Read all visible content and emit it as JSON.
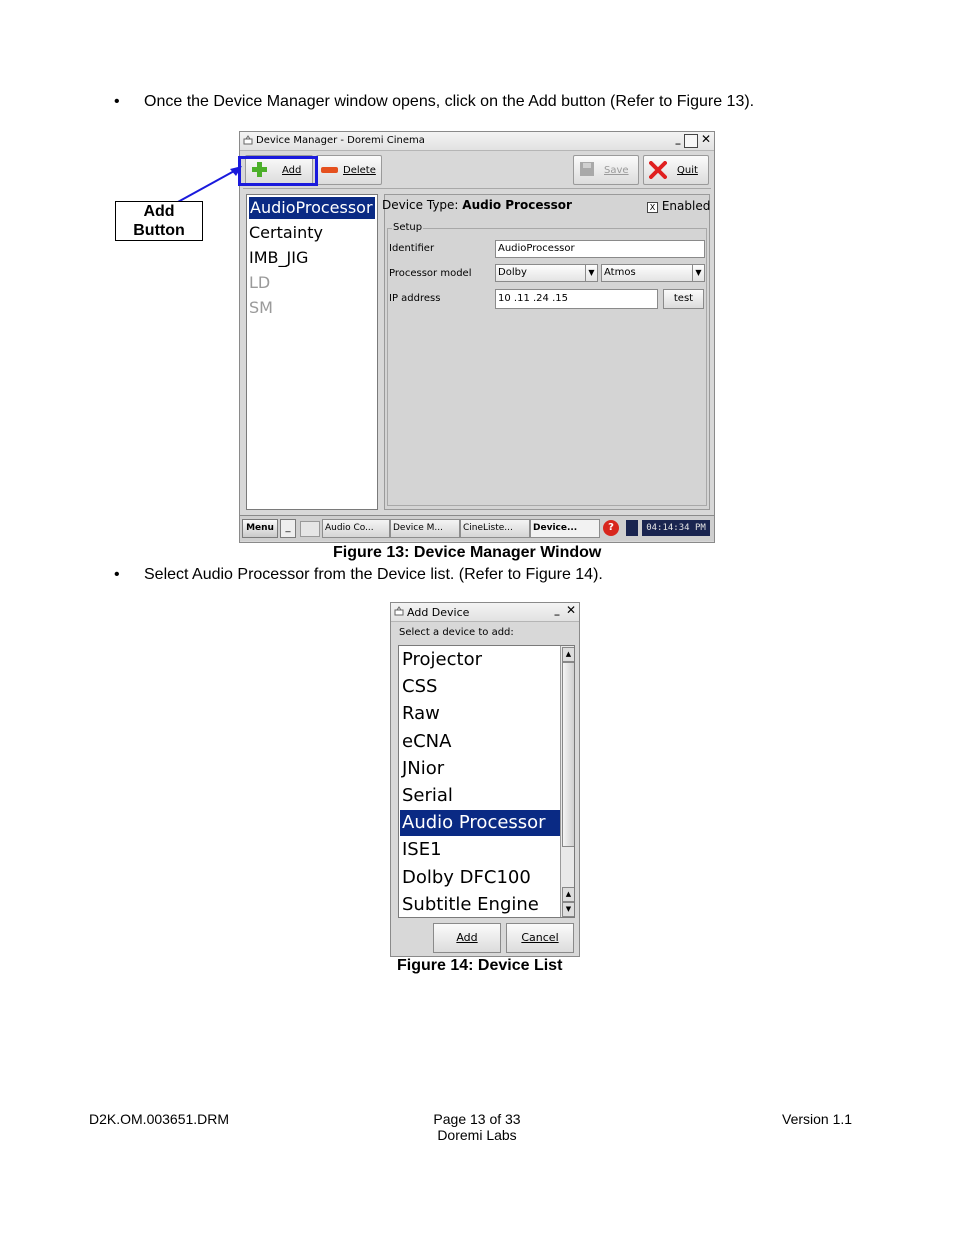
{
  "doc": {
    "bullet1": "Once the Device Manager window opens, click on the Add button (Refer to Figure 13).",
    "bullet2": "Select Audio Processor from the Device list. (Refer to Figure 14).",
    "bullet_char": "•",
    "figure13_caption": "Figure 13: Device Manager Window",
    "figure14_caption": "Figure 14: Device List",
    "callout_label_1": "Add",
    "callout_label_2": "Button",
    "callout_color": "#1a1adc"
  },
  "device_manager": {
    "title": "Device Manager - Doremi Cinema",
    "add_label": "Add",
    "delete_label": "Delete",
    "save_label": "Save",
    "quit_label": "Quit",
    "devices": [
      {
        "label": "AudioProcessor",
        "state": "selected"
      },
      {
        "label": "Certainty",
        "state": "normal"
      },
      {
        "label": "IMB_JIG",
        "state": "normal"
      },
      {
        "label": "LD",
        "state": "disabled"
      },
      {
        "label": "SM",
        "state": "disabled"
      }
    ],
    "device_type_prefix": "Device Type:",
    "device_type_value": "Audio Processor",
    "enabled_check": "X",
    "enabled_label": "Enabled",
    "setup_group": "Setup",
    "identifier_label": "Identifier",
    "identifier_value": "AudioProcessor",
    "processor_model_label": "Processor model",
    "processor_brand": "Dolby",
    "processor_model": "Atmos",
    "ip_label": "IP address",
    "ip_value": "10 .11 .24 .15",
    "test_label": "test",
    "selection_color": "#0a2a84"
  },
  "taskbar": {
    "menu_label": "Menu",
    "items": [
      "Audio Co...",
      "Device M...",
      "CineListe...",
      "Device..."
    ],
    "clock": "04:14:34 PM"
  },
  "add_device": {
    "title": "Add Device",
    "prompt": "Select a device to add:",
    "items": [
      {
        "label": "Projector",
        "selected": false
      },
      {
        "label": "CSS",
        "selected": false
      },
      {
        "label": "Raw",
        "selected": false
      },
      {
        "label": "eCNA",
        "selected": false
      },
      {
        "label": "JNior",
        "selected": false
      },
      {
        "label": "Serial",
        "selected": false
      },
      {
        "label": "Audio Processor",
        "selected": true
      },
      {
        "label": "ISE1",
        "selected": false
      },
      {
        "label": "Dolby DFC100",
        "selected": false
      },
      {
        "label": "Subtitle Engine",
        "selected": false
      }
    ],
    "add_label": "Add",
    "cancel_label": "Cancel"
  },
  "footer": {
    "doc_id": "D2K.OM.003651.DRM",
    "page": "Page 13 of 33",
    "company": "Doremi Labs",
    "version": "Version 1.1"
  }
}
